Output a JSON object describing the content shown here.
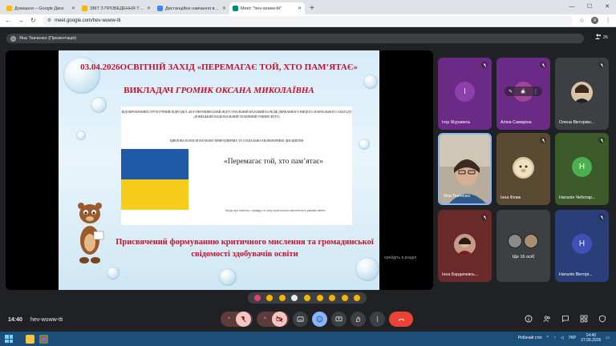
{
  "browser": {
    "tabs": [
      {
        "label": "Домашня – Google Диск",
        "color": "#fbbc04",
        "active": false
      },
      {
        "label": "ЗВІТ З ПРОВЕДЕННЯ ТИЖНЯ",
        "color": "#f4b400",
        "active": false
      },
      {
        "label": "Дистанційне навчання в ВСП",
        "color": "#4285f4",
        "active": false
      },
      {
        "label": "Meet: \"hev-wuww-tti\"",
        "color": "#00897b",
        "active": true
      }
    ],
    "new_tab": "+",
    "url": "meet.google.com/hev-wuww-tti",
    "profile_initial": "Я"
  },
  "meet": {
    "presenter_avatar": "Я",
    "presenter_label": "Яна Ткаченко (Презентація)",
    "participant_count": "26",
    "clock": "14:40",
    "meeting_code": "hev-wuww-tti"
  },
  "slide": {
    "title": "03.04.2026ОСВІТНІЙ ЗАХІД «ПЕРЕМАГАЄ ТОЙ, ХТО ПАМ’ЯТАЄ»",
    "teacher_prefix": "ВИКЛАДАЧ",
    "teacher_name": "ГРОМИК ОКСАНА МИКОЛАЇВНА",
    "doc_header": "ВІДОКРЕМЛЕНИЙ СТРУКТУРНИЙ ПІДРОЗДІЛ «КОСТЯНТИНІВСЬКИЙ ІНДУСТРІАЛЬНИЙ ФАХОВИЙ КОЛЕДЖ ДЕРЖАВНОГО ВИЩОГО НАВЧАЛЬНОГО ЗАКЛАДУ «ДОНЕЦЬКИЙ НАЦІОНАЛЬНИЙ ТЕХНІЧНИЙ УНІВЕРСИТЕТ»",
    "commission": "ЦИКЛОВА КОМІСІЯ НАУКОВО-ПРИРОДНИЧИХ ТА СОЦІАЛЬНО-ЕКОНОМІЧНИХ ДИСЦИПЛІН",
    "event_name": "«Перемагає той, хто пам’ятає»",
    "event_desc": "Захід про пам'ять, правду та силу критичного мислення в умовах війни",
    "dedication": "Присвячений формуванню критичного мислення та громадянської свідомості здобувачів освіти",
    "overflow_text": "ерейдіть в розділ"
  },
  "participants": [
    {
      "name": "Ігор Журавель",
      "initial": "І",
      "bg": "#6b2a85",
      "avatar": "#8e3fae",
      "type": "initial"
    },
    {
      "name": "Аліна Самаріна",
      "initial": "A",
      "bg": "#6b2a85",
      "avatar": "#a0459c",
      "type": "initial"
    },
    {
      "name": "Олена Вікторівн...",
      "initial": "",
      "bg": "#3c4043",
      "avatar": "#d9c4a8",
      "type": "photo"
    },
    {
      "name": "Яна Ткаченко",
      "initial": "",
      "bg": "#8a7f6e",
      "avatar": "#d9b59a",
      "type": "video"
    },
    {
      "name": "Інна Філик",
      "initial": "",
      "bg": "#5a4a32",
      "avatar": "#d8c9a3",
      "type": "photo"
    },
    {
      "name": "Наталія Чеботар...",
      "initial": "Н",
      "bg": "#3d5a2a",
      "avatar": "#4caf50",
      "type": "initial"
    },
    {
      "name": "Інна Бардачевсь...",
      "initial": "",
      "bg": "#6a2a2a",
      "avatar": "#c49a8a",
      "type": "photo"
    },
    {
      "name": "Ще 16 осіб",
      "initial": "",
      "bg": "#3c4043",
      "avatar": "#8a8a8a",
      "type": "group"
    },
    {
      "name": "Наталія Вікторі...",
      "initial": "Н",
      "bg": "#2a3e7a",
      "avatar": "#3f51b5",
      "type": "initial"
    }
  ],
  "reactions": [
    "#e6406f",
    "#f4b400",
    "#f4b400",
    "#e8eaed",
    "#f4b400",
    "#f4b400",
    "#f4b400",
    "#f4b400",
    "#f4b400"
  ],
  "colors": {
    "meet_bg": "#202124",
    "accent_red": "#c8102e",
    "end_call": "#ea4335",
    "flag_blue": "#1f5aa8",
    "flag_yellow": "#f6cd1a"
  },
  "taskbar": {
    "locale": "УКР",
    "time": "14:40",
    "date": "27.05.2026",
    "desktop_label": "Робочий стіл"
  }
}
